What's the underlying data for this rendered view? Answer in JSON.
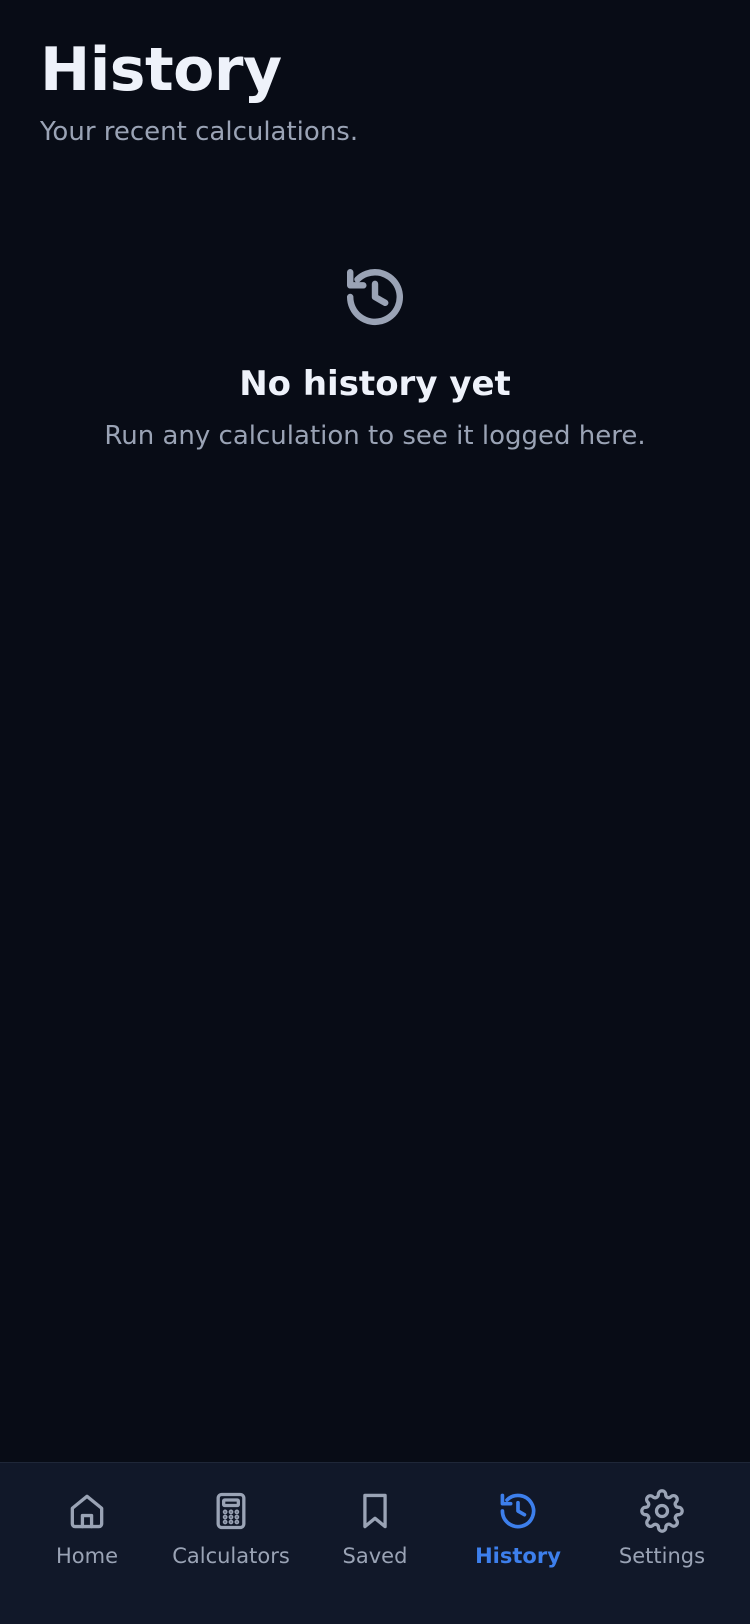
{
  "page": {
    "title": "History",
    "subtitle": "Your recent calculations."
  },
  "empty_state": {
    "icon": "history-icon",
    "title": "No history yet",
    "text": "Run any calculation to see it logged here."
  },
  "tabbar": {
    "items": [
      {
        "label": "Home",
        "icon": "home-icon",
        "active": false
      },
      {
        "label": "Calculators",
        "icon": "calculator-icon",
        "active": false
      },
      {
        "label": "Saved",
        "icon": "bookmark-icon",
        "active": false
      },
      {
        "label": "History",
        "icon": "history-icon",
        "active": true
      },
      {
        "label": "Settings",
        "icon": "gear-icon",
        "active": false
      }
    ]
  },
  "colors": {
    "background": "#080c16",
    "tabbar_background": "#111829",
    "accent": "#3d7fec",
    "muted": "#9aa3b5",
    "text": "#eef2fa"
  }
}
